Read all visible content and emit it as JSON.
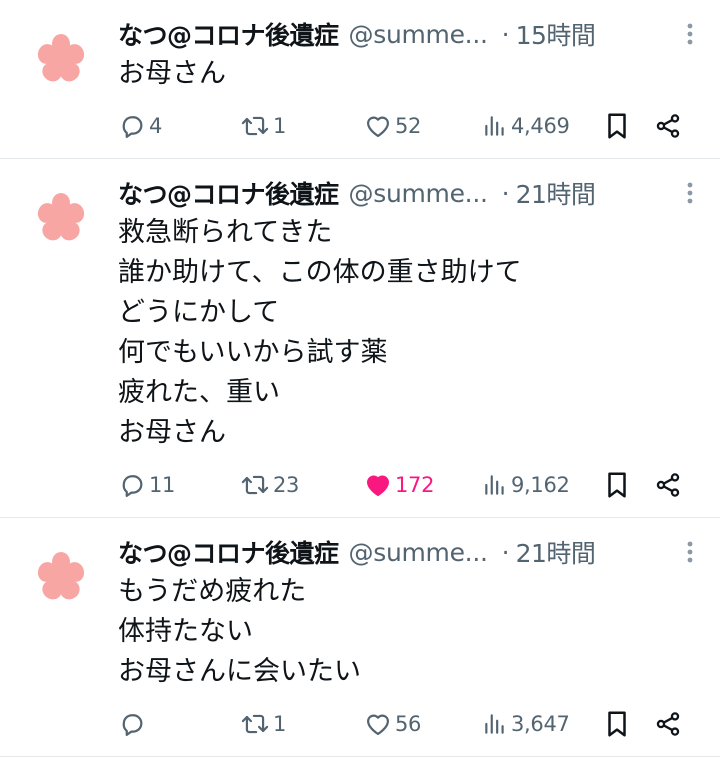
{
  "colors": {
    "text": "#0f1419",
    "secondary": "#536471",
    "like_active": "#f91880",
    "avatar": "#f7a6a3",
    "divider": "#e6e9eb"
  },
  "tweets": [
    {
      "avatar_icon": "sakura-flower-icon",
      "name": "なつ@コロナ後遺症",
      "handle": "@summe...",
      "dot": "·",
      "time": "15時間",
      "lines": [
        "お母さん"
      ],
      "replies": "4",
      "retweets": "1",
      "likes": "52",
      "liked": false,
      "views": "4,469"
    },
    {
      "avatar_icon": "sakura-flower-icon",
      "name": "なつ@コロナ後遺症",
      "handle": "@summe...",
      "dot": "·",
      "time": "21時間",
      "lines": [
        "救急断られてきた",
        "誰か助けて、この体の重さ助けて",
        "どうにかして",
        "何でもいいから試す薬",
        "疲れた、重い",
        "お母さん"
      ],
      "replies": "11",
      "retweets": "23",
      "likes": "172",
      "liked": true,
      "views": "9,162"
    },
    {
      "avatar_icon": "sakura-flower-icon",
      "name": "なつ@コロナ後遺症",
      "handle": "@summe...",
      "dot": "·",
      "time": "21時間",
      "lines": [
        "もうだめ疲れた",
        "体持たない",
        "お母さんに会いたい"
      ],
      "replies": "",
      "retweets": "1",
      "likes": "56",
      "liked": false,
      "views": "3,647"
    }
  ]
}
